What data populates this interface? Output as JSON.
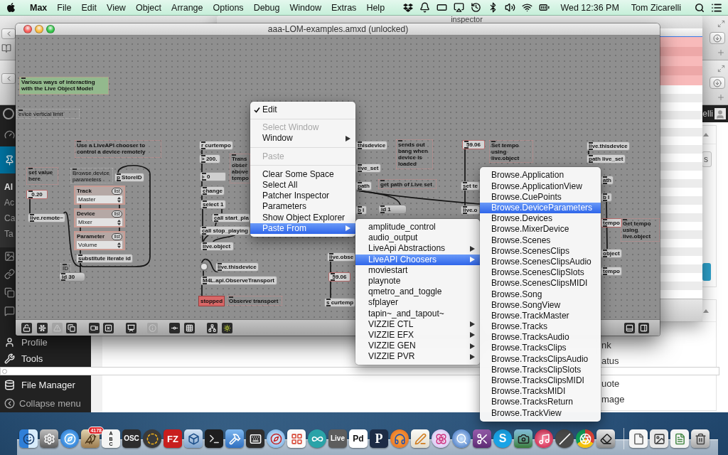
{
  "menu_bar": {
    "app": "Max",
    "menus": [
      "File",
      "Edit",
      "View",
      "Object",
      "Arrange",
      "Options",
      "Debug",
      "Window",
      "Extras",
      "Help"
    ],
    "clock": "Wed 12:36 PM",
    "user": "Tom Zicarelli"
  },
  "browser": {
    "admin_user": "elli",
    "submenu": [
      {
        "label": "Al",
        "selected": true
      },
      {
        "label": "Ac",
        "selected": false
      },
      {
        "label": "Ca",
        "selected": false
      },
      {
        "label": "Ta",
        "selected": false
      }
    ],
    "menu": [
      "Profile",
      "Tools",
      "File Manager",
      "Collapse menu"
    ],
    "button_fragment": "s",
    "format_fragments": [
      "nk",
      "atus",
      "uote",
      "mage"
    ]
  },
  "inspector": {
    "title": "inspector"
  },
  "patcher": {
    "title": "aaa-LOM-examples.amxd (unlocked)",
    "objects": [
      {
        "kind": "banner",
        "text": "Various ways of interacting with the Live Object Model"
      },
      {
        "kind": "label",
        "text": "evice vertical limit"
      },
      {
        "kind": "comment",
        "text": "Use a LiveAPI chooser to control a device remotely"
      },
      {
        "kind": "comment",
        "text": "set value here"
      },
      {
        "kind": "label",
        "text": "Browse device parameters"
      },
      {
        "kind": "object",
        "text": "p StoreID"
      },
      {
        "kind": "numbox",
        "text": "0.20"
      },
      {
        "kind": "chooser",
        "label": "Track",
        "button": "list",
        "value": "Master"
      },
      {
        "kind": "object",
        "text": "live.remote~"
      },
      {
        "kind": "chooser",
        "label": "Device",
        "button": "list",
        "value": "Mixer"
      },
      {
        "kind": "chooser",
        "label": "Parameter",
        "button": "list",
        "value": "Volume"
      },
      {
        "kind": "object",
        "text": "substitute iterate id"
      },
      {
        "kind": "label",
        "text": "ID"
      },
      {
        "kind": "message",
        "text": "id 30"
      },
      {
        "kind": "object",
        "text": "r curtempo"
      },
      {
        "kind": "object",
        "text": "> 200."
      },
      {
        "kind": "comment",
        "text": "Trans obser above tempo"
      },
      {
        "kind": "number",
        "text": "0"
      },
      {
        "kind": "object",
        "text": "change"
      },
      {
        "kind": "object",
        "text": "select 1"
      },
      {
        "kind": "object",
        "text": "call start_pla"
      },
      {
        "kind": "object",
        "text": "call stop_playing"
      },
      {
        "kind": "object",
        "text": "live.object"
      },
      {
        "kind": "bang"
      },
      {
        "kind": "object",
        "text": "live.thisdevice"
      },
      {
        "kind": "object",
        "text": "M4L.api.ObserveTransport"
      },
      {
        "kind": "indicator",
        "text": "stopped"
      },
      {
        "kind": "comment",
        "text": "Observe transport"
      },
      {
        "kind": "object",
        "text": "thisdevice"
      },
      {
        "kind": "object",
        "text": "live_set"
      },
      {
        "kind": "object",
        "text": "path"
      },
      {
        "kind": "comment",
        "text": "get path of Live set"
      },
      {
        "kind": "object",
        "text": "b l"
      },
      {
        "kind": "message",
        "text": "id 1"
      },
      {
        "kind": "comment",
        "text": "sends out bang when device is loaded"
      },
      {
        "kind": "object",
        "text": "live.obse"
      },
      {
        "kind": "numbox",
        "text": "59.06"
      },
      {
        "kind": "object",
        "text": "s curtemp"
      },
      {
        "kind": "numbox",
        "text": "59.06"
      },
      {
        "kind": "comment",
        "text": "Set tempo using live.object"
      },
      {
        "kind": "object",
        "text": "set te"
      },
      {
        "kind": "object",
        "text": "live.o"
      },
      {
        "kind": "object",
        "text": "live.thisdevice"
      },
      {
        "kind": "object",
        "text": "path live_set"
      },
      {
        "kind": "object",
        "text": "ath"
      },
      {
        "kind": "object",
        "text": "b l"
      },
      {
        "kind": "numbox",
        "text": "tempo"
      },
      {
        "kind": "comment",
        "text": "Get tempo using live.object"
      },
      {
        "kind": "object",
        "text": "object"
      },
      {
        "kind": "object",
        "text": "tempo"
      }
    ],
    "toolbar": [
      {
        "disabled": false
      },
      {
        "disabled": false
      },
      {
        "disabled": true
      },
      {
        "disabled": false
      },
      {
        "disabled": false
      },
      {
        "disabled": false
      },
      {
        "disabled": false
      },
      {
        "disabled": true
      },
      {
        "disabled": false
      },
      {
        "disabled": false
      },
      {
        "disabled": false
      },
      {
        "disabled": false
      },
      {
        "disabled": false
      },
      {
        "disabled": false
      }
    ]
  },
  "context_menu": {
    "groups": [
      [
        {
          "label": "Edit",
          "checked": true,
          "disabled": false,
          "selected": false,
          "has_submenu": false
        }
      ],
      [
        {
          "label": "Select Window",
          "checked": false,
          "disabled": true,
          "selected": false,
          "has_submenu": false
        },
        {
          "label": "Window",
          "checked": false,
          "disabled": false,
          "selected": false,
          "has_submenu": true
        }
      ],
      [
        {
          "label": "Paste",
          "checked": false,
          "disabled": true,
          "selected": false,
          "has_submenu": false
        }
      ],
      [
        {
          "label": "Clear Some Space",
          "checked": false,
          "disabled": false,
          "selected": false,
          "has_submenu": false
        },
        {
          "label": "Select All",
          "checked": false,
          "disabled": false,
          "selected": false,
          "has_submenu": false
        },
        {
          "label": "Patcher Inspector",
          "checked": false,
          "disabled": false,
          "selected": false,
          "has_submenu": false
        },
        {
          "label": "Parameters",
          "checked": false,
          "disabled": false,
          "selected": false,
          "has_submenu": false
        },
        {
          "label": "Show Object Explorer",
          "checked": false,
          "disabled": false,
          "selected": false,
          "has_submenu": false
        },
        {
          "label": "Paste From",
          "checked": false,
          "disabled": false,
          "selected": true,
          "has_submenu": true
        }
      ]
    ]
  },
  "paste_from_menu": {
    "items": [
      {
        "label": "amplitude_control",
        "selected": false,
        "has_submenu": false
      },
      {
        "label": "audio_output",
        "selected": false,
        "has_submenu": false
      },
      {
        "label": "LiveApi Abstractions",
        "selected": false,
        "has_submenu": true
      },
      {
        "label": "LiveAPI Choosers",
        "selected": true,
        "has_submenu": true
      },
      {
        "label": "moviestart",
        "selected": false,
        "has_submenu": false
      },
      {
        "label": "playnote",
        "selected": false,
        "has_submenu": false
      },
      {
        "label": "qmetro_and_toggle",
        "selected": false,
        "has_submenu": false
      },
      {
        "label": "sfplayer",
        "selected": false,
        "has_submenu": false
      },
      {
        "label": "tapin~_and_tapout~",
        "selected": false,
        "has_submenu": false
      },
      {
        "label": "VIZZIE CTL",
        "selected": false,
        "has_submenu": true
      },
      {
        "label": "VIZZIE EFX",
        "selected": false,
        "has_submenu": true
      },
      {
        "label": "VIZZIE GEN",
        "selected": false,
        "has_submenu": true
      },
      {
        "label": "VIZZIE PVR",
        "selected": false,
        "has_submenu": true
      }
    ]
  },
  "choosers_menu": {
    "items": [
      {
        "label": "Browse.Application",
        "selected": false
      },
      {
        "label": "Browse.ApplicationView",
        "selected": false
      },
      {
        "label": "Browse.CuePoints",
        "selected": false
      },
      {
        "label": "Browse.DeviceParameters",
        "selected": true
      },
      {
        "label": "Browse.Devices",
        "selected": false
      },
      {
        "label": "Browse.MixerDevice",
        "selected": false
      },
      {
        "label": "Browse.Scenes",
        "selected": false
      },
      {
        "label": "Browse.ScenesClips",
        "selected": false
      },
      {
        "label": "Browse.ScenesClipsAudio",
        "selected": false
      },
      {
        "label": "Browse.ScenesClipSlots",
        "selected": false
      },
      {
        "label": "Browse.ScenesClipsMIDI",
        "selected": false
      },
      {
        "label": "Browse.Song",
        "selected": false
      },
      {
        "label": "Browse.SongView",
        "selected": false
      },
      {
        "label": "Browse.TrackMaster",
        "selected": false
      },
      {
        "label": "Browse.Tracks",
        "selected": false
      },
      {
        "label": "Browse.TracksAudio",
        "selected": false
      },
      {
        "label": "Browse.TracksClips",
        "selected": false
      },
      {
        "label": "Browse.TracksClipsAudio",
        "selected": false
      },
      {
        "label": "Browse.TracksClipSlots",
        "selected": false
      },
      {
        "label": "Browse.TracksClipsMIDI",
        "selected": false
      },
      {
        "label": "Browse.TracksMIDI",
        "selected": false
      },
      {
        "label": "Browse.TracksReturn",
        "selected": false
      },
      {
        "label": "Browse.TrackView",
        "selected": false
      }
    ]
  },
  "dock": {
    "badge": "4178",
    "labels": [
      "ABC",
      "OSC",
      "FZ",
      "Live",
      "Pd",
      "P",
      "S"
    ]
  }
}
